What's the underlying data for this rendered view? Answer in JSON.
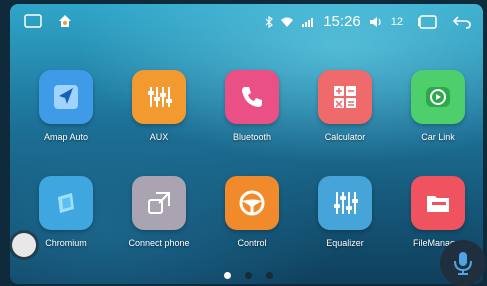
{
  "status_bar": {
    "time": "15:26",
    "volume": "12",
    "icons": [
      "home-outline-icon",
      "home-color-icon",
      "bluetooth-icon",
      "wifi-icon",
      "signal-icon",
      "volume-icon",
      "recent-apps-icon",
      "back-icon"
    ]
  },
  "apps": [
    {
      "label": "Amap Auto",
      "icon": "navigation-arrow-icon",
      "color": "#3f9be8"
    },
    {
      "label": "AUX",
      "icon": "equalizer-sliders-icon",
      "color": "#f29a2f"
    },
    {
      "label": "Bluetooth",
      "icon": "phone-handset-icon",
      "color": "#ea4f86"
    },
    {
      "label": "Calculator",
      "icon": "calculator-icon",
      "color": "#ef6a6a"
    },
    {
      "label": "Car Link",
      "icon": "carplay-icon",
      "color": "#4fcf6b"
    },
    {
      "label": "Chromium",
      "icon": "chromium-icon",
      "color": "#3fa6e0"
    },
    {
      "label": "Connect phone",
      "icon": "connect-phone-icon",
      "color": "#a9a3b2"
    },
    {
      "label": "Control",
      "icon": "steering-wheel-icon",
      "color": "#f08a2a"
    },
    {
      "label": "Equalizer",
      "icon": "equalizer-icon",
      "color": "#47a4d8"
    },
    {
      "label": "FileManager",
      "icon": "folder-icon",
      "color": "#ef5360"
    }
  ],
  "pager": {
    "pages": 3,
    "current": 1
  },
  "floating": {
    "assist": "assistive-touch-icon",
    "voice": "microphone-icon"
  }
}
